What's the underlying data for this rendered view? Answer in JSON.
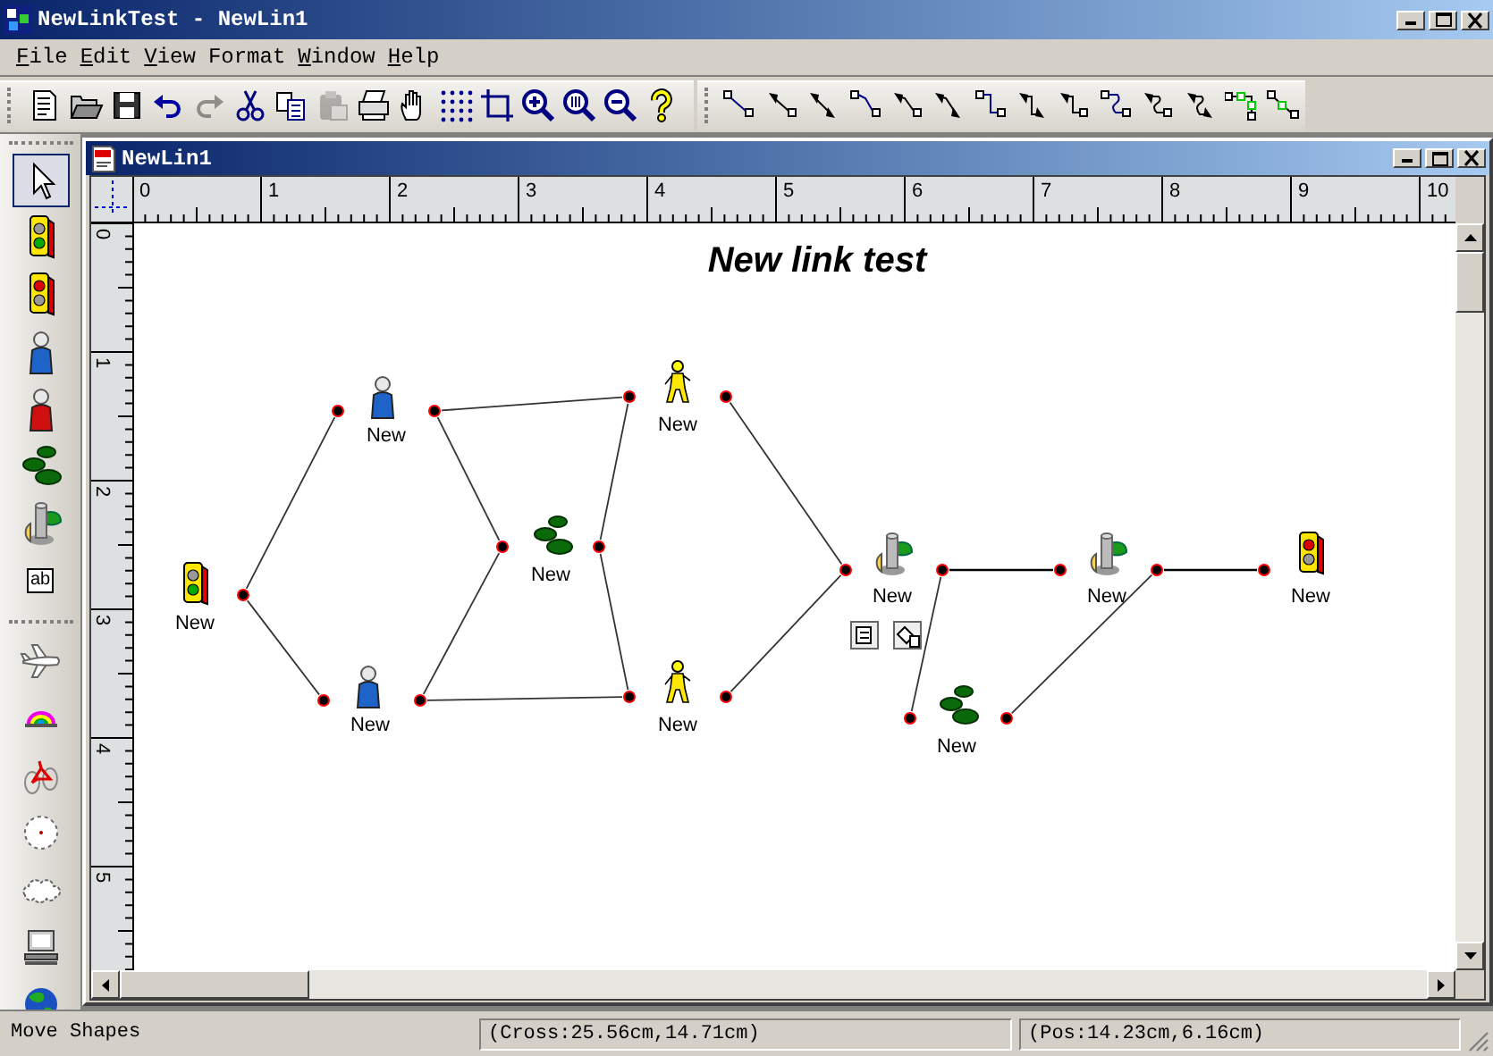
{
  "window": {
    "title": "NewLinkTest - NewLin1"
  },
  "menu": [
    {
      "label": "File",
      "mnemonic": true
    },
    {
      "label": "Edit",
      "mnemonic": true
    },
    {
      "label": "View",
      "mnemonic": true
    },
    {
      "label": "Format",
      "mnemonic": false
    },
    {
      "label": "Window",
      "mnemonic": true
    },
    {
      "label": "Help",
      "mnemonic": true
    }
  ],
  "toolbar": [
    {
      "kind": "new",
      "disabled": false
    },
    {
      "kind": "open",
      "disabled": false
    },
    {
      "kind": "save",
      "disabled": false
    },
    {
      "kind": "undo",
      "disabled": false
    },
    {
      "kind": "redo",
      "disabled": true
    },
    {
      "kind": "cut",
      "disabled": false
    },
    {
      "kind": "copy",
      "disabled": false
    },
    {
      "kind": "paste",
      "disabled": true
    },
    {
      "kind": "print",
      "disabled": false
    },
    {
      "kind": "hand",
      "disabled": false
    },
    {
      "kind": "grid",
      "disabled": false
    },
    {
      "kind": "crop",
      "disabled": false
    },
    {
      "kind": "zoom-in",
      "disabled": false
    },
    {
      "kind": "zoom-fit",
      "disabled": false
    },
    {
      "kind": "zoom-out",
      "disabled": false
    },
    {
      "kind": "help",
      "disabled": false
    }
  ],
  "palette": [
    [
      {
        "kind": "pointer",
        "selected": true
      },
      {
        "kind": "traffic-light-green",
        "selected": false
      },
      {
        "kind": "traffic-light-red",
        "selected": false
      },
      {
        "kind": "person",
        "selected": false
      },
      {
        "kind": "person-red",
        "selected": false
      },
      {
        "kind": "lily-pads",
        "selected": false
      },
      {
        "kind": "server",
        "selected": false
      },
      {
        "kind": "text",
        "label": "ab",
        "selected": false
      }
    ],
    [
      {
        "kind": "plane",
        "selected": false
      },
      {
        "kind": "rainbow",
        "selected": false
      },
      {
        "kind": "bicycle",
        "selected": false
      },
      {
        "kind": "clock",
        "selected": false
      },
      {
        "kind": "cloud",
        "selected": false
      },
      {
        "kind": "computer",
        "selected": false
      },
      {
        "kind": "globe",
        "selected": false
      }
    ]
  ],
  "document": {
    "title": "NewLin1",
    "rulers": {
      "horizontal": [
        "0",
        "1",
        "2",
        "3",
        "4",
        "5",
        "6",
        "7",
        "8",
        "9",
        "10"
      ],
      "vertical": [
        "0",
        "1",
        "2",
        "3",
        "4",
        "5"
      ]
    },
    "diagram": {
      "title": "New link test",
      "shapes": [
        {
          "kind": "traffic-light-green",
          "label": "New",
          "selected": false
        },
        {
          "kind": "person",
          "label": "New",
          "selected": false
        },
        {
          "kind": "person",
          "label": "New",
          "selected": false
        },
        {
          "kind": "lily-pads",
          "label": "New",
          "selected": false
        },
        {
          "kind": "worker",
          "label": "New",
          "selected": false
        },
        {
          "kind": "worker",
          "label": "New",
          "selected": false
        },
        {
          "kind": "server",
          "label": "New",
          "selected": true
        },
        {
          "kind": "server",
          "label": "New",
          "selected": false
        },
        {
          "kind": "traffic-light-red",
          "label": "New",
          "selected": false
        },
        {
          "kind": "lily-pads",
          "label": "New",
          "selected": false
        }
      ]
    }
  },
  "status_bar": [
    "Move Shapes",
    "(Cross:25.56cm,14.71cm)",
    "(Pos:14.23cm,6.16cm)"
  ]
}
